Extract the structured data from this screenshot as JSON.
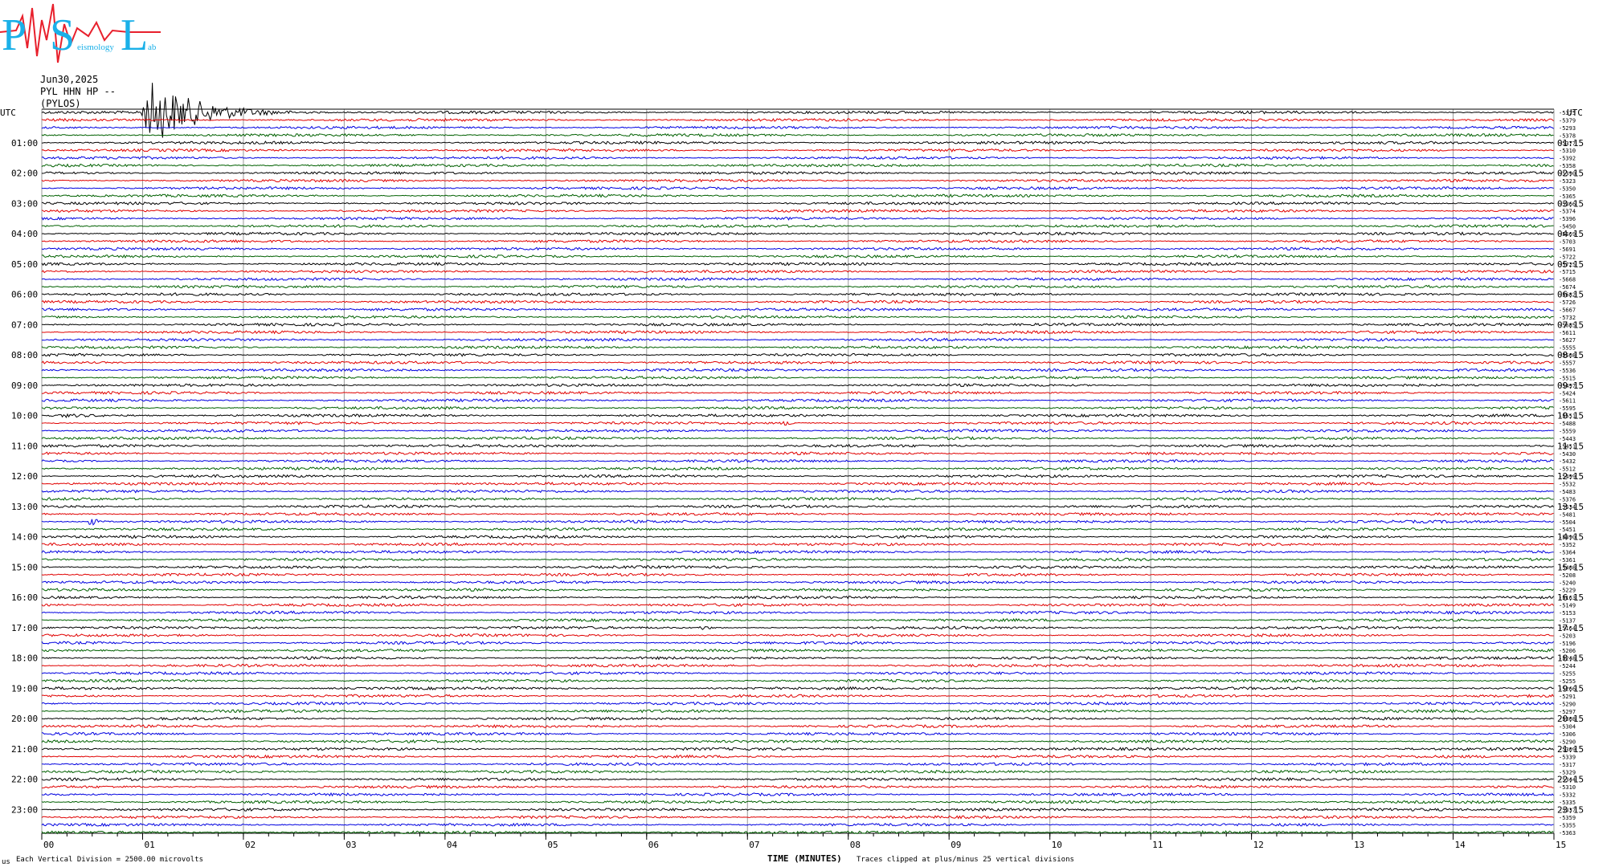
{
  "logo": {
    "letters": [
      "P",
      "S",
      "L"
    ],
    "words": [
      "eismology",
      "ab"
    ]
  },
  "header": {
    "date": "Jun30,2025",
    "station": "PYL HHN HP --",
    "location": "(PYLOS)"
  },
  "footer": {
    "left_mark": "us",
    "vertical_division": "Each Vertical Division = 2500.00 microvolts",
    "clip_note": "Traces clipped at plus/minus 25 vertical divisions"
  },
  "colors": {
    "trace_cycle": [
      "#000000",
      "#e00000",
      "#0000e0",
      "#006000"
    ],
    "logo": "#1ab0e8",
    "logo_accent": "#e8202c"
  },
  "chart_data": {
    "type": "line",
    "subtype": "helicorder",
    "xlabel": "TIME (MINUTES)",
    "xlim": [
      0,
      15
    ],
    "x_ticks": [
      "00",
      "01",
      "02",
      "03",
      "04",
      "05",
      "06",
      "07",
      "08",
      "09",
      "10",
      "11",
      "12",
      "13",
      "14",
      "15"
    ],
    "grid": "vertical",
    "left_axis_title": "UTC",
    "right_axis_title": "UTC",
    "left_hour_labels": [
      "01:00",
      "02:00",
      "03:00",
      "04:00",
      "05:00",
      "06:00",
      "07:00",
      "08:00",
      "09:00",
      "10:00",
      "11:00",
      "12:00",
      "13:00",
      "14:00",
      "15:00",
      "16:00",
      "17:00",
      "18:00",
      "19:00",
      "20:00",
      "21:00",
      "22:00",
      "23:00"
    ],
    "right_hour_labels": [
      "01:15",
      "02:15",
      "03:15",
      "04:15",
      "05:15",
      "06:15",
      "07:15",
      "08:15",
      "09:15",
      "10:15",
      "11:15",
      "12:15",
      "13:15",
      "14:15",
      "15:15",
      "16:15",
      "17:15",
      "18:15",
      "19:15",
      "20:15",
      "21:15",
      "22:15",
      "23:15"
    ],
    "rows_per_hour": 4,
    "row_count": 96,
    "trace_offsets": [
      "-5375",
      "-5379",
      "-5293",
      "-5378",
      "-5377",
      "-5310",
      "-5392",
      "-5358",
      "-5390",
      "-5323",
      "-5350",
      "-5365",
      "-5366",
      "-5374",
      "-5396",
      "-5450",
      "-5669",
      "-5703",
      "-5691",
      "-5722",
      "-5725",
      "-5715",
      "-5668",
      "-5674",
      "-5682",
      "-5726",
      "-5667",
      "-5732",
      "-5685",
      "-5611",
      "-5627",
      "-5555",
      "-5508",
      "-5557",
      "-5536",
      "-5515",
      "-5497",
      "-5424",
      "-5611",
      "-5595",
      "-5551",
      "-5488",
      "-5559",
      "-5443",
      "-5451",
      "-5430",
      "-5432",
      "-5512",
      "-5499",
      "-5532",
      "-5483",
      "-5376",
      "-5534",
      "-5481",
      "-5504",
      "-5451",
      "-5390",
      "-5352",
      "-5364",
      "-5361",
      "-5408",
      "-5208",
      "-5240",
      "-5229",
      "-5163",
      "-5149",
      "-5153",
      "-5137",
      "-5164",
      "-5203",
      "-5196",
      "-5206",
      "-5248",
      "-5244",
      "-5255",
      "-5255",
      "-5266",
      "-5291",
      "-5290",
      "-5297",
      "-5308",
      "-5304",
      "-5306",
      "-5290",
      "-5309",
      "-5339",
      "-5317",
      "-5329",
      "-5344",
      "-5310",
      "-5332",
      "-5335",
      "-5337",
      "-5359",
      "-5355",
      "-5363"
    ],
    "events": [
      {
        "row": 0,
        "start_min": 0.95,
        "duration_min": 1.9,
        "peak_divisions": 25
      },
      {
        "row": 54,
        "start_min": 0.45,
        "duration_min": 0.35,
        "peak_divisions": 4
      },
      {
        "row": 68,
        "start_min": 6.5,
        "duration_min": 0.5,
        "peak_divisions": 2
      },
      {
        "row": 41,
        "start_min": 7.3,
        "duration_min": 0.7,
        "peak_divisions": 2
      },
      {
        "row": 40,
        "start_min": 0.0,
        "duration_min": 3.0,
        "peak_divisions": 1.5
      }
    ]
  }
}
